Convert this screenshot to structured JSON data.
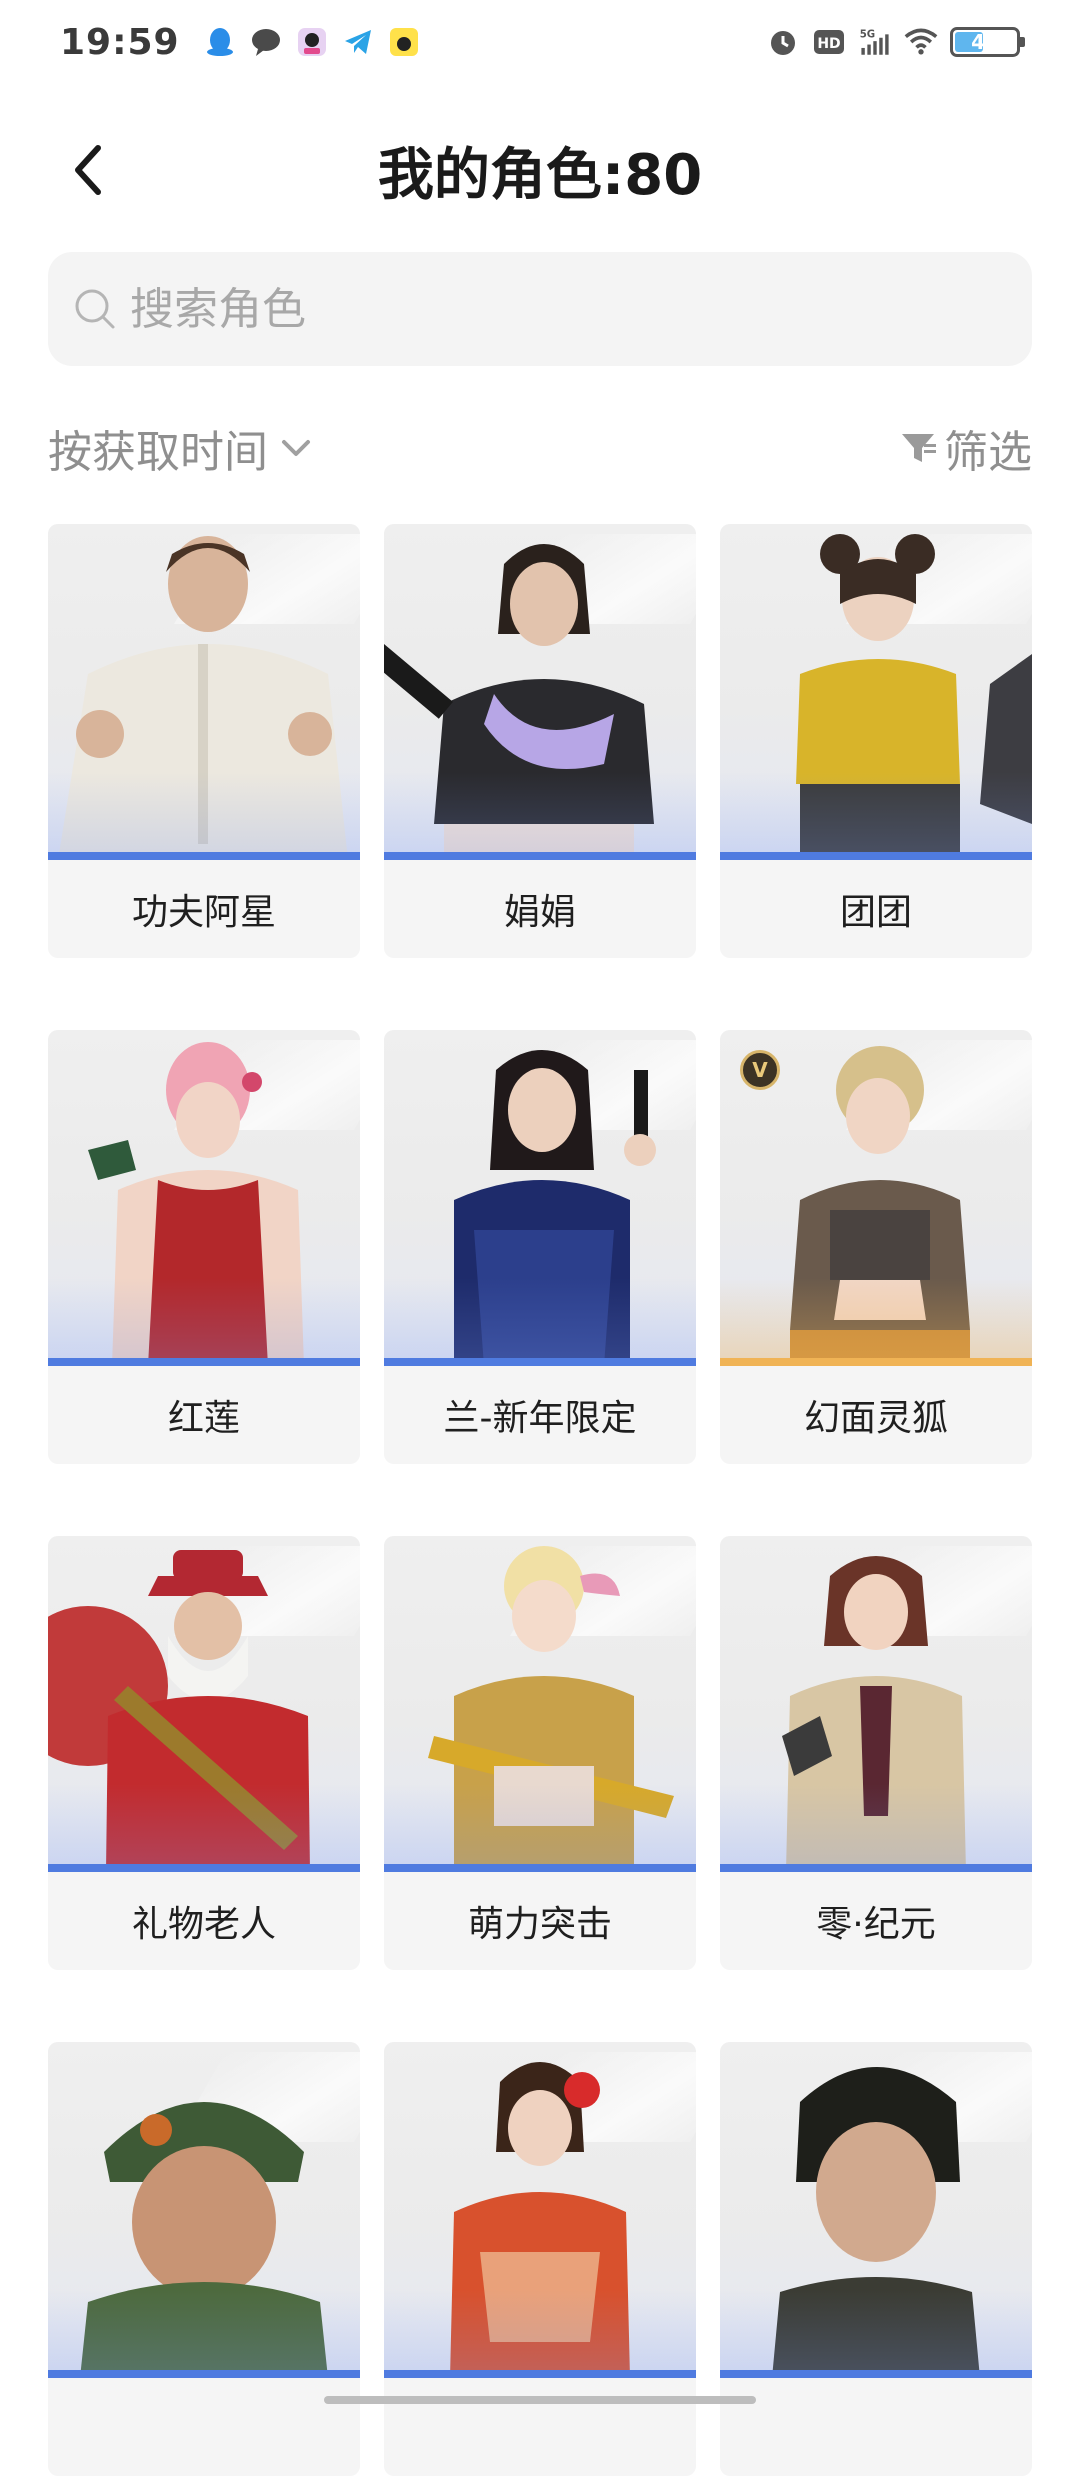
{
  "status_bar": {
    "time": "19:59",
    "battery_level": "47",
    "network": "5G",
    "hd_label": "HD",
    "notification_icons": [
      "qq-icon",
      "message-icon",
      "app-icon",
      "telegram-icon",
      "cartoon-app-icon"
    ]
  },
  "header": {
    "title": "我的角色:80",
    "back_icon": "chevron-left-icon"
  },
  "search": {
    "placeholder": "搜索角色",
    "value": ""
  },
  "toolbar": {
    "sort_label": "按获取时间",
    "filter_label": "筛选"
  },
  "characters": [
    {
      "name": "功夫阿星",
      "rarity": "blue"
    },
    {
      "name": "娟娟",
      "rarity": "blue"
    },
    {
      "name": "团团",
      "rarity": "blue"
    },
    {
      "name": "红莲",
      "rarity": "blue"
    },
    {
      "name": "兰-新年限定",
      "rarity": "blue"
    },
    {
      "name": "幻面灵狐",
      "rarity": "gold",
      "badge": "V"
    },
    {
      "name": "礼物老人",
      "rarity": "blue"
    },
    {
      "name": "萌力突击",
      "rarity": "blue"
    },
    {
      "name": "零·纪元",
      "rarity": "blue"
    },
    {
      "name": "",
      "rarity": "blue"
    },
    {
      "name": "",
      "rarity": "blue"
    },
    {
      "name": "",
      "rarity": "blue"
    }
  ],
  "colors": {
    "rarity_blue": "#4f7be0",
    "rarity_gold": "#f0b355",
    "card_bg": "#f5f5f5",
    "search_bg": "#f4f4f4"
  }
}
